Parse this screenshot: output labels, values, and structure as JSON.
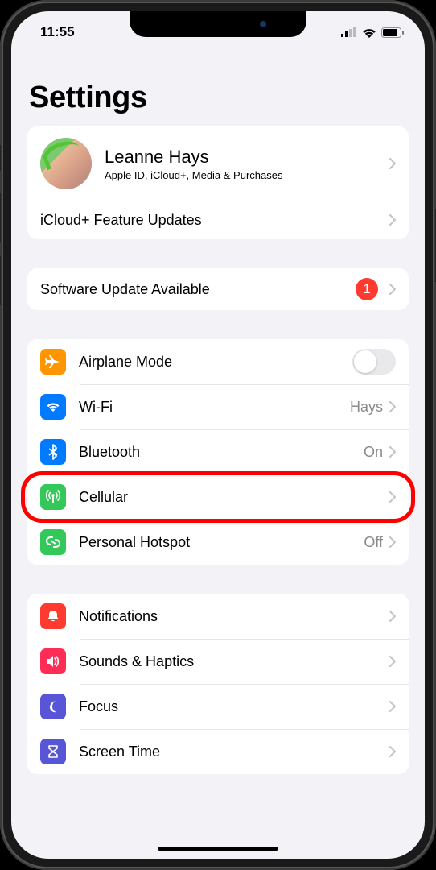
{
  "status": {
    "time": "11:55"
  },
  "title": "Settings",
  "profile": {
    "name": "Leanne Hays",
    "subtitle": "Apple ID, iCloud+, Media & Purchases",
    "featureUpdates": "iCloud+ Feature Updates"
  },
  "softwareUpdate": {
    "label": "Software Update Available",
    "badge": "1"
  },
  "network": {
    "airplane": {
      "label": "Airplane Mode",
      "on": false
    },
    "wifi": {
      "label": "Wi-Fi",
      "value": "Hays"
    },
    "bluetooth": {
      "label": "Bluetooth",
      "value": "On"
    },
    "cellular": {
      "label": "Cellular"
    },
    "hotspot": {
      "label": "Personal Hotspot",
      "value": "Off"
    }
  },
  "general": {
    "notifications": {
      "label": "Notifications"
    },
    "sounds": {
      "label": "Sounds & Haptics"
    },
    "focus": {
      "label": "Focus"
    },
    "screentime": {
      "label": "Screen Time"
    }
  },
  "colors": {
    "orange": "#ff9500",
    "blue": "#007aff",
    "green": "#34c759",
    "red": "#ff3b30",
    "pink": "#ff2d55",
    "indigo": "#5856d6"
  }
}
